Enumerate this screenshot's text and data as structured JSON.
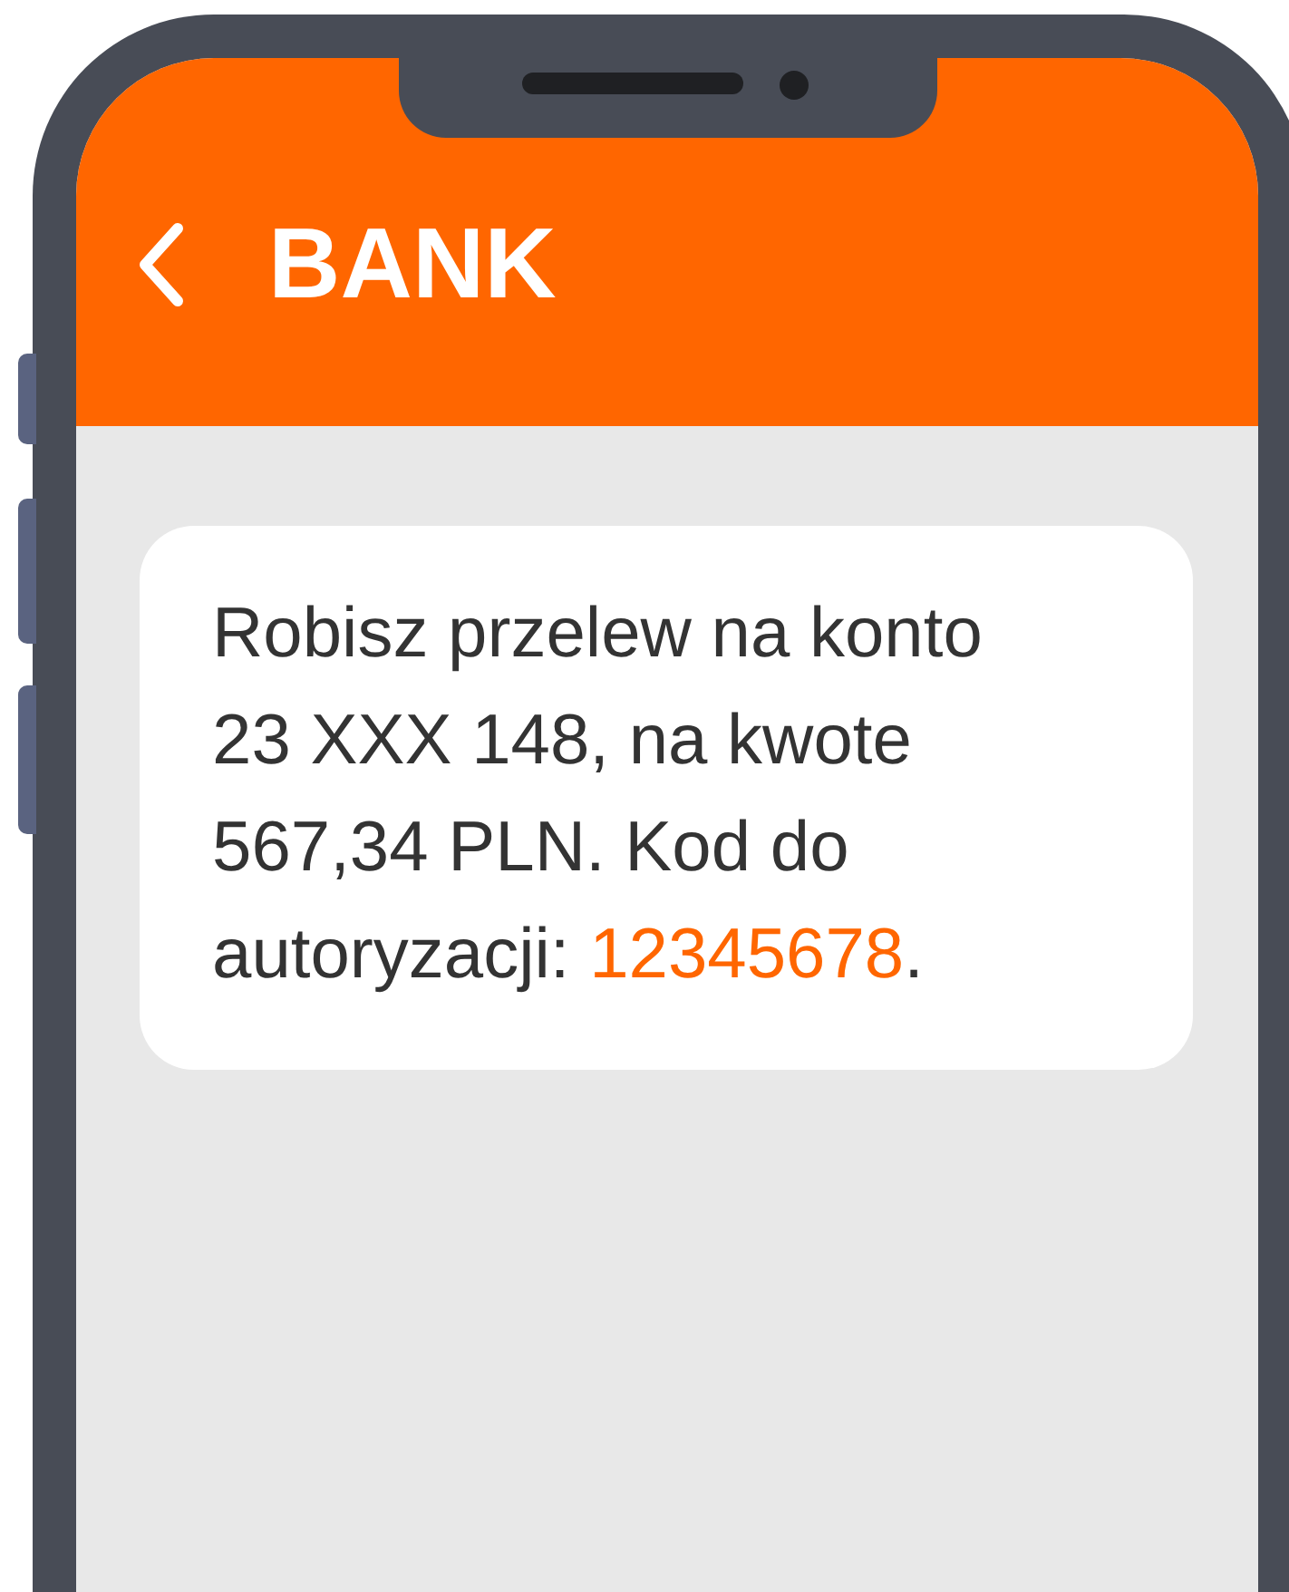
{
  "header": {
    "title": "BANK"
  },
  "message": {
    "parts": [
      {
        "text": "Robisz przelew na konto 23 XXX 148, na kwote 567,34 PLN. Kod do autoryzacji: ",
        "highlight": false
      },
      {
        "text": "12345678",
        "highlight": true
      },
      {
        "text": ".",
        "highlight": false
      }
    ]
  }
}
